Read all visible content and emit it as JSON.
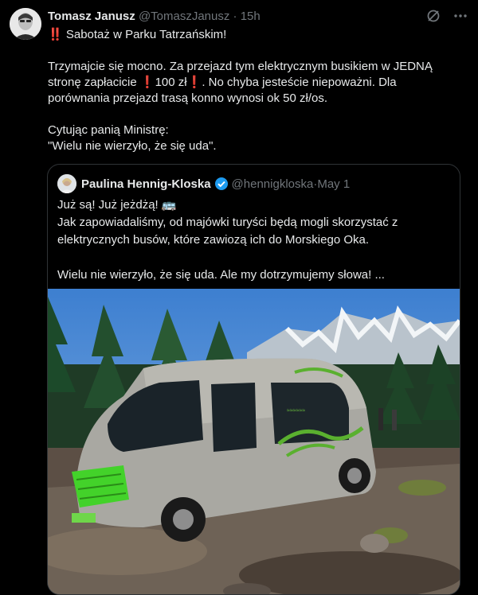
{
  "author": {
    "name": "Tomasz Janusz",
    "handle": "@TomaszJanusz",
    "separator": "·",
    "time": "15h"
  },
  "tweet": {
    "line1_marks": "‼️",
    "line1_text": " Sabotaż w Parku Tatrzańskim!",
    "para2_a": "Trzymajcie się mocno. Za przejazd tym elektrycznym busikiem w JEDNĄ",
    "para2_b": "stronę zapłacicie ",
    "para2_mark1": "❗",
    "para2_price": "100 zł",
    "para2_mark2": "❗",
    "para2_c": ". No chyba jesteście niepoważni. Dla",
    "para2_d": "porównania przejazd trasą konno wynosi ok 50 zł/os.",
    "para3_a": "Cytując panią Ministrę:",
    "para3_b": "\"Wielu nie wierzyło, że się uda\"."
  },
  "quote": {
    "name": "Paulina Hennig-Kloska",
    "handle": "@hennigkloska",
    "separator": "·",
    "date": "May 1",
    "line1": "Już są! Już jeżdżą! 🚌",
    "line2": "Jak zapowiadaliśmy, od majówki turyści będą mogli skorzystać z",
    "line3": "elektrycznych busów, które zawiozą ich do Morskiego Oka.",
    "line4": "Wielu nie wierzyło, że się uda. Ale my dotrzymujemy słowa! ..."
  },
  "icons": {
    "grok": "grok-icon",
    "more": "more-icon",
    "verified": "verified-badge-icon"
  },
  "colors": {
    "background": "#000000",
    "text": "#e7e9ea",
    "muted": "#71767b",
    "border": "#2f3336",
    "verified": "#1d9bf0",
    "alert": "#f4212e"
  }
}
